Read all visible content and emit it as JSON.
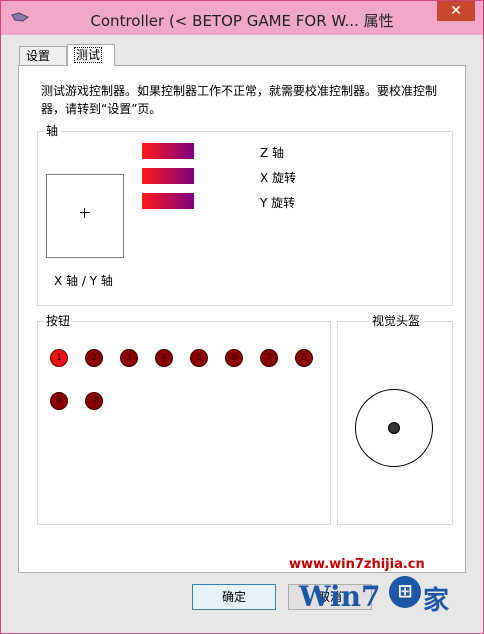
{
  "window": {
    "title": "Controller (< BETOP GAME FOR W... 属性",
    "close": "✕"
  },
  "tabs": [
    {
      "label": "设置"
    },
    {
      "label": "测试"
    }
  ],
  "intro": "测试游戏控制器。如果控制器工作不正常，就需要校准控制器。要校准控制器，请转到“设置”页。",
  "axes": {
    "group_label": "轴",
    "xy_label": "X 轴 / Y 轴",
    "bars": [
      {
        "label": "Z 轴"
      },
      {
        "label": "X 旋转"
      },
      {
        "label": "Y 旋转"
      }
    ]
  },
  "buttons": {
    "group_label": "按钮",
    "items": [
      {
        "number": "1",
        "pressed": true
      },
      {
        "number": "2",
        "pressed": false
      },
      {
        "number": "3",
        "pressed": false
      },
      {
        "number": "4",
        "pressed": false
      },
      {
        "number": "5",
        "pressed": false
      },
      {
        "number": "6",
        "pressed": false
      },
      {
        "number": "7",
        "pressed": false
      },
      {
        "number": "8",
        "pressed": false
      },
      {
        "number": "9",
        "pressed": false
      },
      {
        "number": "10",
        "pressed": false
      }
    ]
  },
  "hat": {
    "group_label": "视觉头盔"
  },
  "footer": {
    "ok": "确定",
    "cancel": "取消"
  },
  "watermark": {
    "url": "www.win7zhijia.cn",
    "brand": "Win7",
    "home": "家"
  }
}
